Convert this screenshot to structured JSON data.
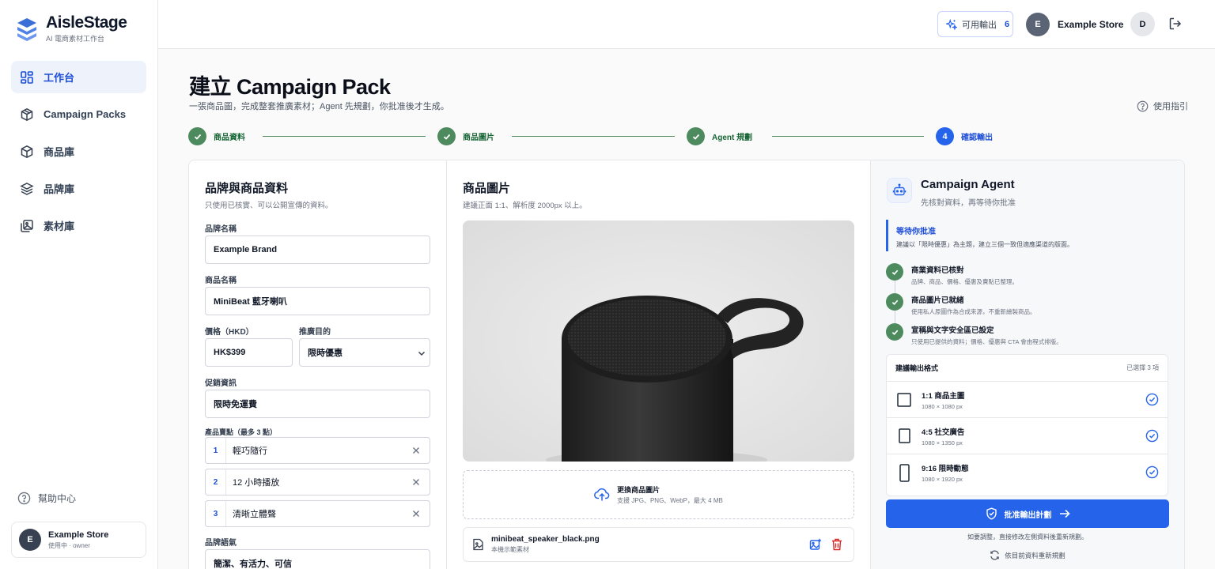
{
  "app": {
    "name": "AisleStage",
    "tagline": "AI 電商素材工作台"
  },
  "nav": {
    "items": [
      {
        "label": "工作台",
        "icon": "dashboard-icon",
        "active": true
      },
      {
        "label": "Campaign Packs",
        "icon": "package-icon"
      },
      {
        "label": "商品庫",
        "icon": "box-icon"
      },
      {
        "label": "品牌庫",
        "icon": "layers-icon"
      },
      {
        "label": "素材庫",
        "icon": "images-icon"
      }
    ],
    "help": "幫助中心"
  },
  "account": {
    "initial": "E",
    "name": "Example Store",
    "role": "使用中 · owner",
    "user_initial": "D"
  },
  "topbar": {
    "credits_label": "可用輸出",
    "credits_count": "6",
    "store_name": "Example Store"
  },
  "page": {
    "title": "建立 Campaign Pack",
    "subtitle": "一張商品圖，完成整套推廣素材；Agent 先規劃，你批准後才生成。",
    "guide": "使用指引"
  },
  "steps": [
    {
      "label": "商品資料",
      "state": "done"
    },
    {
      "label": "商品圖片",
      "state": "done"
    },
    {
      "label": "Agent 規劃",
      "state": "done"
    },
    {
      "label": "確認輸出",
      "state": "current",
      "number": "4"
    }
  ],
  "form": {
    "title": "品牌與商品資料",
    "subtitle": "只使用已核實、可以公開宣傳的資料。",
    "brand_label": "品牌名稱",
    "brand_value": "Example Brand",
    "product_label": "商品名稱",
    "product_value": "MiniBeat 藍牙喇叭",
    "price_label": "價格（HKD）",
    "price_value": "HK$399",
    "goal_label": "推廣目的",
    "goal_value": "限時優惠",
    "promo_label": "促銷資訊",
    "promo_value": "限時免運費",
    "points_label": "產品賣點（最多 3 點）",
    "points": [
      {
        "num": "1",
        "text": "輕巧隨行"
      },
      {
        "num": "2",
        "text": "12 小時播放"
      },
      {
        "num": "3",
        "text": "清晰立體聲"
      }
    ],
    "tone_label": "品牌語氣",
    "tone_value": "簡潔、有活力、可信"
  },
  "image": {
    "title": "商品圖片",
    "subtitle": "建議正面 1:1、解析度 2000px 以上。",
    "upload_title": "更換商品圖片",
    "upload_sub": "支援 JPG、PNG、WebP，最大 4 MB",
    "file_name": "minibeat_speaker_black.png",
    "file_sub": "本機示範素材"
  },
  "agent": {
    "title": "Campaign Agent",
    "subtitle": "先核對資料，再等待你批准",
    "waiting_title": "等待你批准",
    "waiting_sub": "建議以「限時優惠」為主題，建立三個一致但適應渠道的版面。",
    "checks": [
      {
        "title": "商業資料已核對",
        "sub": "品牌、商品、價格、優惠及賣點已整理。"
      },
      {
        "title": "商品圖片已就緒",
        "sub": "使用私人原圖作為合成來源，不重新繪製商品。"
      },
      {
        "title": "宣稱與文字安全區已設定",
        "sub": "只使用已提供的資料；價格、優惠與 CTA 會由程式排版。"
      }
    ],
    "formats_title": "建議輸出格式",
    "formats_selected": "已選擇 3 項",
    "formats": [
      {
        "title": "1:1 商品主圖",
        "size": "1080 × 1080 px",
        "ratio": "1:1"
      },
      {
        "title": "4:5 社交廣告",
        "size": "1080 × 1350 px",
        "ratio": "4:5"
      },
      {
        "title": "9:16 限時動態",
        "size": "1080 × 1920 px",
        "ratio": "9:16"
      }
    ],
    "approve_label": "批准輸出計劃",
    "approve_note": "如要調整，直接修改左側資料後重新規劃。",
    "regen_label": "依目前資料重新規劃"
  },
  "colors": {
    "primary": "#2563eb",
    "success": "#4d8b5f",
    "text": "#111827"
  }
}
